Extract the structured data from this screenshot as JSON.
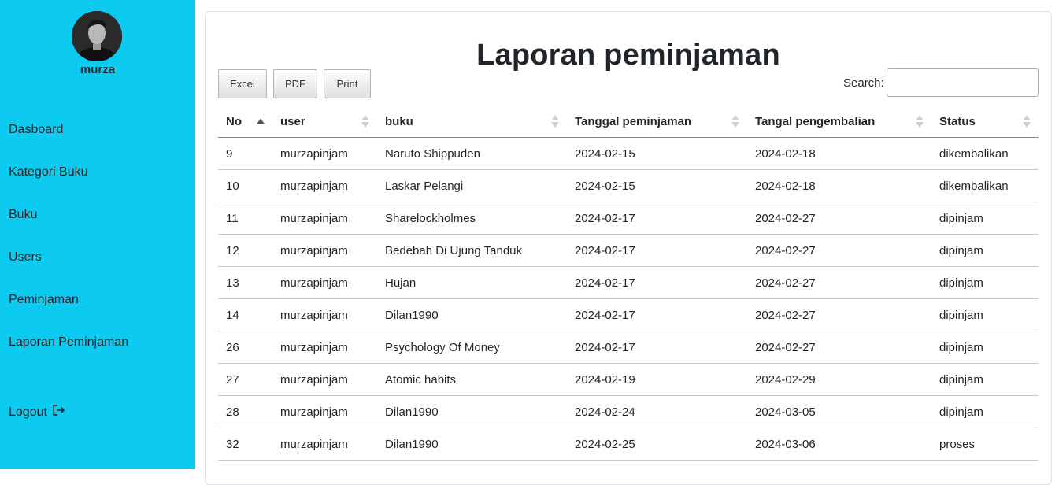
{
  "sidebar": {
    "username": "murza",
    "nav": [
      {
        "label": "Dasboard"
      },
      {
        "label": "Kategori Buku"
      },
      {
        "label": "Buku"
      },
      {
        "label": "Users"
      },
      {
        "label": "Peminjaman"
      },
      {
        "label": "Laporan Peminjaman"
      }
    ],
    "logout_label": "Logout",
    "background": "#0dcaf0"
  },
  "main": {
    "title": "Laporan peminjaman",
    "buttons": {
      "excel": "Excel",
      "pdf": "PDF",
      "print": "Print"
    },
    "search": {
      "label": "Search:",
      "value": "",
      "placeholder": ""
    },
    "table": {
      "columns": [
        "No",
        "user",
        "buku",
        "Tanggal peminjaman",
        "Tangal pengembalian",
        "Status"
      ],
      "sorted_column": "No",
      "sort_direction": "ascending",
      "rows": [
        [
          "9",
          "murzapinjam",
          "Naruto Shippuden",
          "2024-02-15",
          "2024-02-18",
          "dikembalikan"
        ],
        [
          "10",
          "murzapinjam",
          "Laskar Pelangi",
          "2024-02-15",
          "2024-02-18",
          "dikembalikan"
        ],
        [
          "11",
          "murzapinjam",
          "Sharelockholmes",
          "2024-02-17",
          "2024-02-27",
          "dipinjam"
        ],
        [
          "12",
          "murzapinjam",
          "Bedebah Di Ujung Tanduk",
          "2024-02-17",
          "2024-02-27",
          "dipinjam"
        ],
        [
          "13",
          "murzapinjam",
          "Hujan",
          "2024-02-17",
          "2024-02-27",
          "dipinjam"
        ],
        [
          "14",
          "murzapinjam",
          "Dilan1990",
          "2024-02-17",
          "2024-02-27",
          "dipinjam"
        ],
        [
          "26",
          "murzapinjam",
          "Psychology Of Money",
          "2024-02-17",
          "2024-02-27",
          "dipinjam"
        ],
        [
          "27",
          "murzapinjam",
          "Atomic habits",
          "2024-02-19",
          "2024-02-29",
          "dipinjam"
        ],
        [
          "28",
          "murzapinjam",
          "Dilan1990",
          "2024-02-24",
          "2024-03-05",
          "dipinjam"
        ],
        [
          "32",
          "murzapinjam",
          "Dilan1990",
          "2024-02-25",
          "2024-03-06",
          "proses"
        ]
      ]
    }
  }
}
